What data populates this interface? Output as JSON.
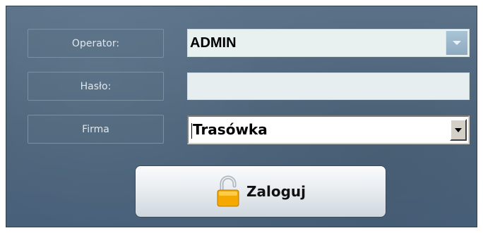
{
  "form": {
    "operator_label": "Operator:",
    "password_label": "Hasło:",
    "company_label": "Firma"
  },
  "fields": {
    "operator_value": "ADMIN",
    "password_value": "",
    "company_value": "Trasówka"
  },
  "buttons": {
    "login_label": "Zaloguj"
  },
  "icons": {
    "operator_dropdown": "chevron-down-icon",
    "company_dropdown": "chevron-down-icon",
    "login": "padlock-open-icon"
  },
  "colors": {
    "panel": "#536b82",
    "lock_body": "#f5a800",
    "lock_shackle": "#c0c8d0"
  }
}
